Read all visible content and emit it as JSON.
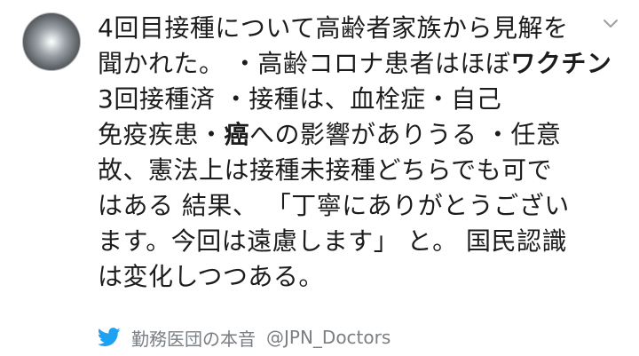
{
  "tweet": {
    "lines": [
      "4回目接種について高齢者家族から見解を",
      "聞かれた。 ・高齢コロナ患者はほぼ",
      "ワクチン",
      "3回接種済 ・接種は、血栓症・自己",
      "免疫疾患・",
      "癌",
      "への影響がありうる ・任意",
      "故、憲法上は接種未接種どちらでも可で",
      "はある 結果、 「丁寧にありがとうござい",
      "ます。今回は遠慮します」 と。 国民認識",
      "は変化しつつある。"
    ]
  },
  "footer": {
    "name": "勤務医団の本音",
    "handle": "@JPN_Doctors"
  },
  "icons": {
    "brand": "twitter-bird-icon",
    "menu": "chevron-down-icon"
  },
  "colors": {
    "twitter_blue": "#1da1f2",
    "meta_gray": "#7a7f84"
  }
}
